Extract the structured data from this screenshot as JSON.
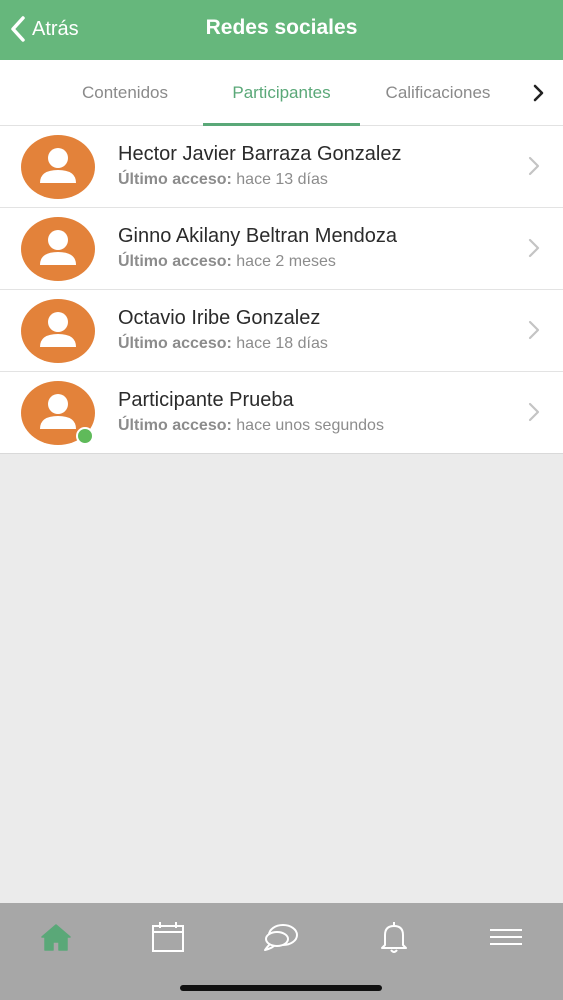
{
  "header": {
    "back_label": "Atrás",
    "title": "Redes sociales"
  },
  "tabs": [
    {
      "label": "Contenidos",
      "active": false
    },
    {
      "label": "Participantes",
      "active": true
    },
    {
      "label": "Calificaciones",
      "active": false
    }
  ],
  "participants": [
    {
      "name": "Hector Javier Barraza Gonzalez",
      "access_label": "Último acceso:",
      "access_value": "hace 13 días",
      "online": false
    },
    {
      "name": "Ginno Akilany Beltran Mendoza",
      "access_label": "Último acceso:",
      "access_value": "hace 2 meses",
      "online": false
    },
    {
      "name": "Octavio Iribe Gonzalez",
      "access_label": "Último acceso:",
      "access_value": "hace 18 días",
      "online": false
    },
    {
      "name": "Participante Prueba",
      "access_label": "Último acceso:",
      "access_value": "hace unos segundos",
      "online": true
    }
  ],
  "tabbar": {
    "items": [
      {
        "icon": "home-icon",
        "active": true
      },
      {
        "icon": "calendar-icon",
        "active": false
      },
      {
        "icon": "chat-icon",
        "active": false
      },
      {
        "icon": "bell-icon",
        "active": false
      },
      {
        "icon": "menu-icon",
        "active": false
      }
    ]
  },
  "colors": {
    "brand_green": "#66b77c",
    "active_tab": "#5aa878",
    "avatar_orange": "#e3823a",
    "online_green": "#5fba5a",
    "tabbar_bg": "#a7a7a7"
  }
}
